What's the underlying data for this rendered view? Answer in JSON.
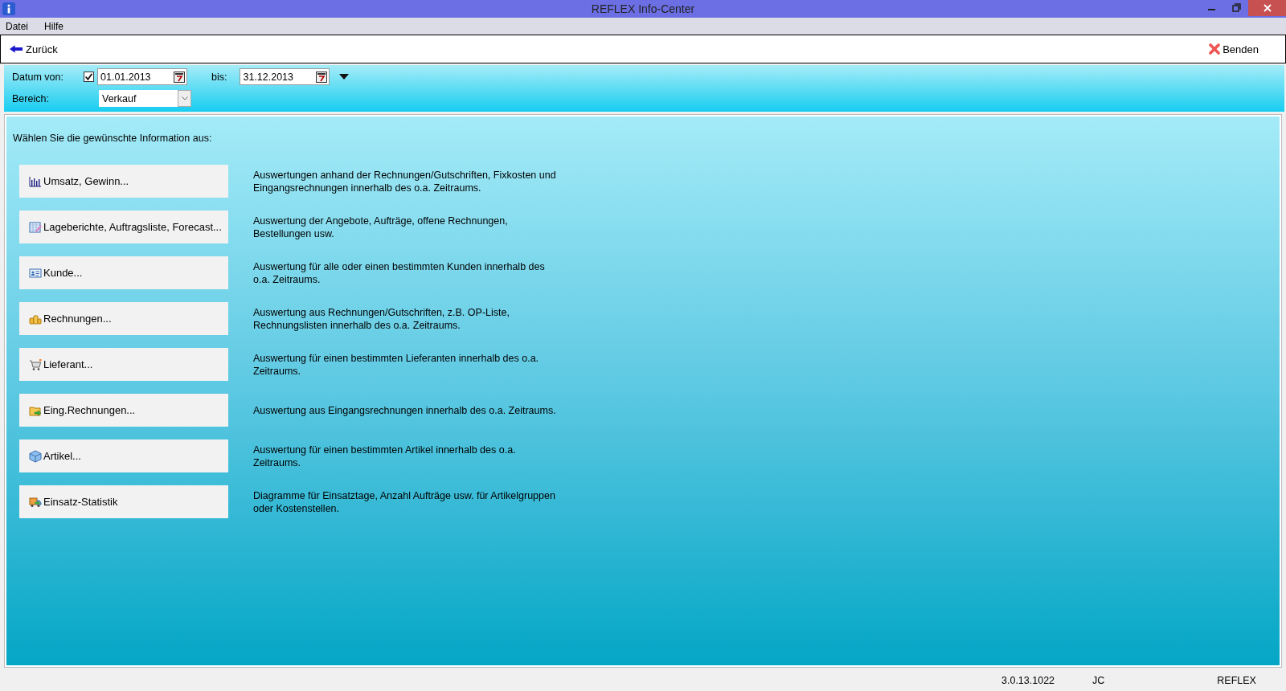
{
  "window": {
    "title": "REFLEX Info-Center"
  },
  "menu": [
    "Datei",
    "Hilfe"
  ],
  "toolbar": {
    "back": "Zurück",
    "exit": "Benden"
  },
  "filter": {
    "date_label": "Datum von:",
    "date_enabled": true,
    "date_from": "01.01.2013",
    "to_label": "bis:",
    "date_to": "31.12.2013",
    "area_label": "Bereich:",
    "area": "Verkauf"
  },
  "prompt": "Wählen Sie die gewünschte Information aus:",
  "options": [
    {
      "label": "Umsatz, Gewinn...",
      "description": "Auswertungen anhand der Rechnungen/Gutschriften, Fixkosten und Eingangsrechnungen innerhalb des o.a. Zeitraums."
    },
    {
      "label": "Lageberichte, Auftragsliste, Forecast...",
      "description": "Auswertung der Angebote, Aufträge, offene Rechnungen, Bestellungen usw."
    },
    {
      "label": "Kunde...",
      "description": "Auswertung für alle oder einen bestimmten Kunden innerhalb des o.a. Zeitraums."
    },
    {
      "label": "Rechnungen...",
      "description": "Auswertung aus Rechnungen/Gutschriften, z.B. OP-Liste, Rechnungslisten innerhalb des o.a. Zeitraums."
    },
    {
      "label": "Lieferant...",
      "description": "Auswertung für einen bestimmten Lieferanten innerhalb des o.a. Zeitraums."
    },
    {
      "label": "Eing.Rechnungen...",
      "description": "Auswertung aus Eingangsrechnungen innerhalb des o.a. Zeitraums."
    },
    {
      "label": "Artikel...",
      "description": "Auswertung für einen bestimmten Artikel innerhalb des o.a. Zeitraums."
    },
    {
      "label": "Einsatz-Statistik",
      "description": "Diagramme für Einsatztage, Anzahl Aufträge usw. für Artikelgruppen oder  Kostenstellen."
    }
  ],
  "status_bar": [
    "3.0.13.1022",
    "JC",
    "REFLEX"
  ]
}
